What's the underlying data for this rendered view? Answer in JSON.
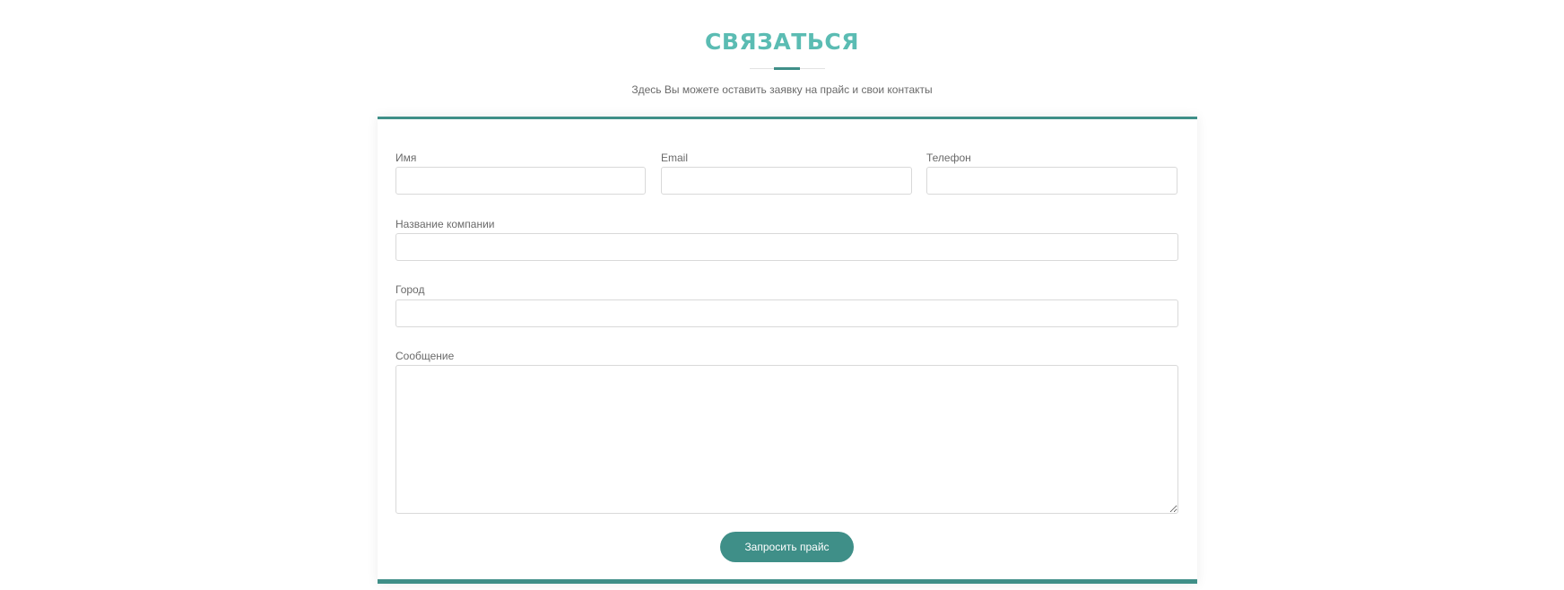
{
  "section": {
    "title": "СВЯЗАТЬСЯ",
    "subtitle": "Здесь Вы можете оставить заявку на прайс и свои контакты"
  },
  "form": {
    "name": {
      "label": "Имя",
      "value": ""
    },
    "email": {
      "label": "Email",
      "value": ""
    },
    "phone": {
      "label": "Телефон",
      "value": ""
    },
    "company": {
      "label": "Название компании",
      "value": ""
    },
    "city": {
      "label": "Город",
      "value": ""
    },
    "message": {
      "label": "Сообщение",
      "value": ""
    },
    "submit_label": "Запросить прайс"
  },
  "colors": {
    "accent": "#3f8f88",
    "title": "#5bbcb3",
    "input_border": "#d9d9d9",
    "label_text": "#6a6a6a"
  }
}
